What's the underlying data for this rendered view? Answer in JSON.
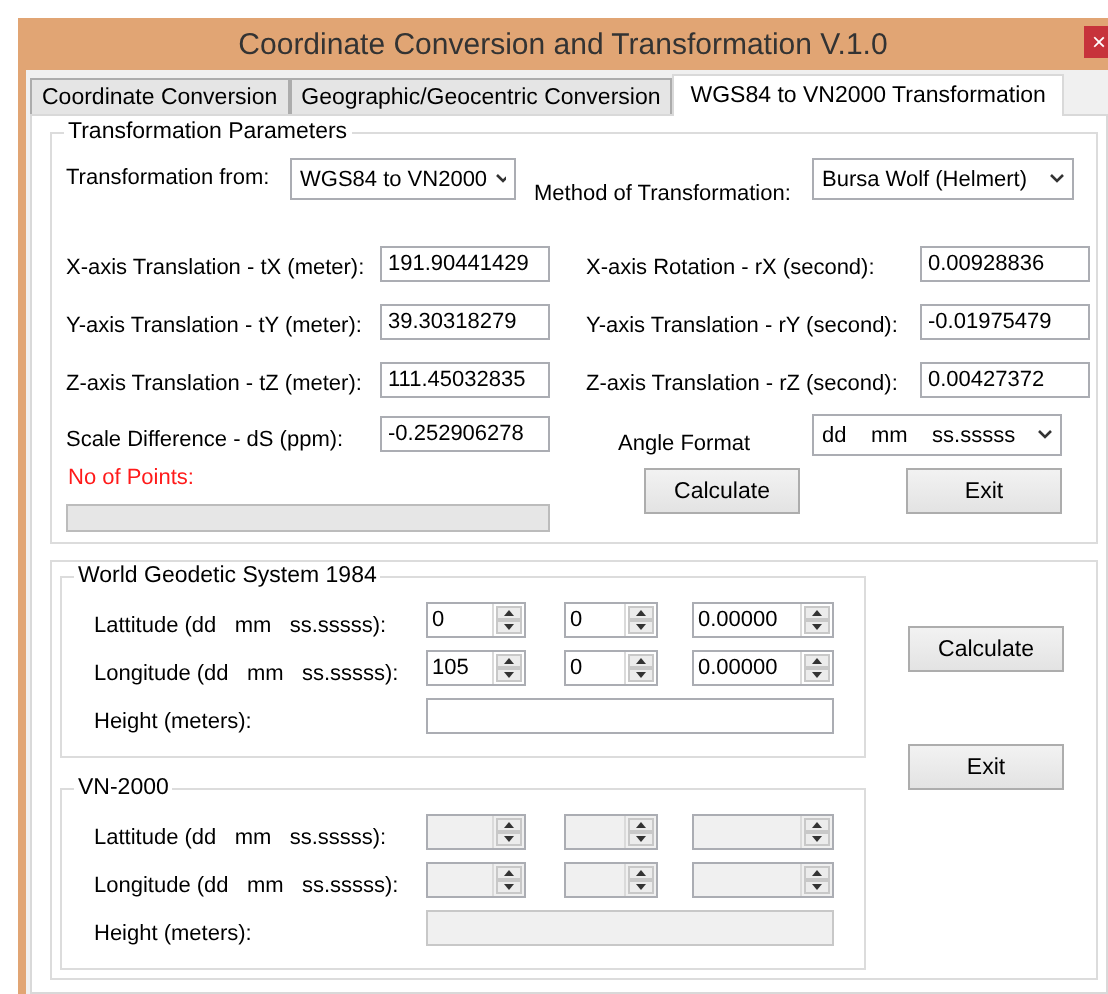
{
  "window": {
    "title": "Coordinate Conversion and Transformation V.1.0",
    "close": "×"
  },
  "tabs": [
    {
      "label": "Coordinate Conversion",
      "selected": false
    },
    {
      "label": "Geographic/Geocentric Conversion",
      "selected": false
    },
    {
      "label": "WGS84 to VN2000 Transformation",
      "selected": true
    }
  ],
  "parameters": {
    "title": "Transformation Parameters",
    "transformation_from": {
      "label": "Transformation from:",
      "value": "WGS84 to VN2000"
    },
    "method": {
      "label": "Method of Transformation:",
      "value": "Bursa Wolf (Helmert)"
    },
    "fields": [
      {
        "label": "X-axis Translation - tX (meter):",
        "value": "191.90441429"
      },
      {
        "label": "X-axis Rotation - rX (second):",
        "value": "0.00928836"
      },
      {
        "label": "Y-axis Translation - tY (meter):",
        "value": "39.30318279"
      },
      {
        "label": "Y-axis Translation - rY (second):",
        "value": "-0.01975479"
      },
      {
        "label": "Z-axis Translation - tZ (meter):",
        "value": "111.45032835"
      },
      {
        "label": "Z-axis Translation - rZ (second):",
        "value": "0.00427372"
      },
      {
        "label": "Scale Difference - dS (ppm):",
        "value": "-0.252906278"
      }
    ],
    "angle_format": {
      "label": "Angle Format",
      "value": "dd    mm    ss.sssss"
    },
    "points_label": "No of Points:",
    "progress": {
      "level": 0
    },
    "buttons": [
      "Calculate",
      "Exit"
    ]
  },
  "wgs84": {
    "title": "World Geodetic System 1984",
    "disabled": false,
    "rows": [
      {
        "label": "Lattitude (dd   mm   ss.sssss):",
        "values": [
          "0",
          "0",
          "0.00000"
        ]
      },
      {
        "label": "Longitude (dd   mm   ss.sssss):",
        "values": [
          "105",
          "0",
          "0.00000"
        ]
      }
    ],
    "height": {
      "label": "Height (meters):"
    }
  },
  "vn2000": {
    "title": "VN-2000",
    "disabled": true,
    "rows": [
      {
        "label": "Lattitude (dd   mm   ss.sssss):"
      },
      {
        "label": "Longitude (dd   mm   ss.sssss):"
      }
    ],
    "height": {
      "label": "Height (meters):"
    }
  },
  "buttons": [
    "Calculate",
    "Exit"
  ]
}
